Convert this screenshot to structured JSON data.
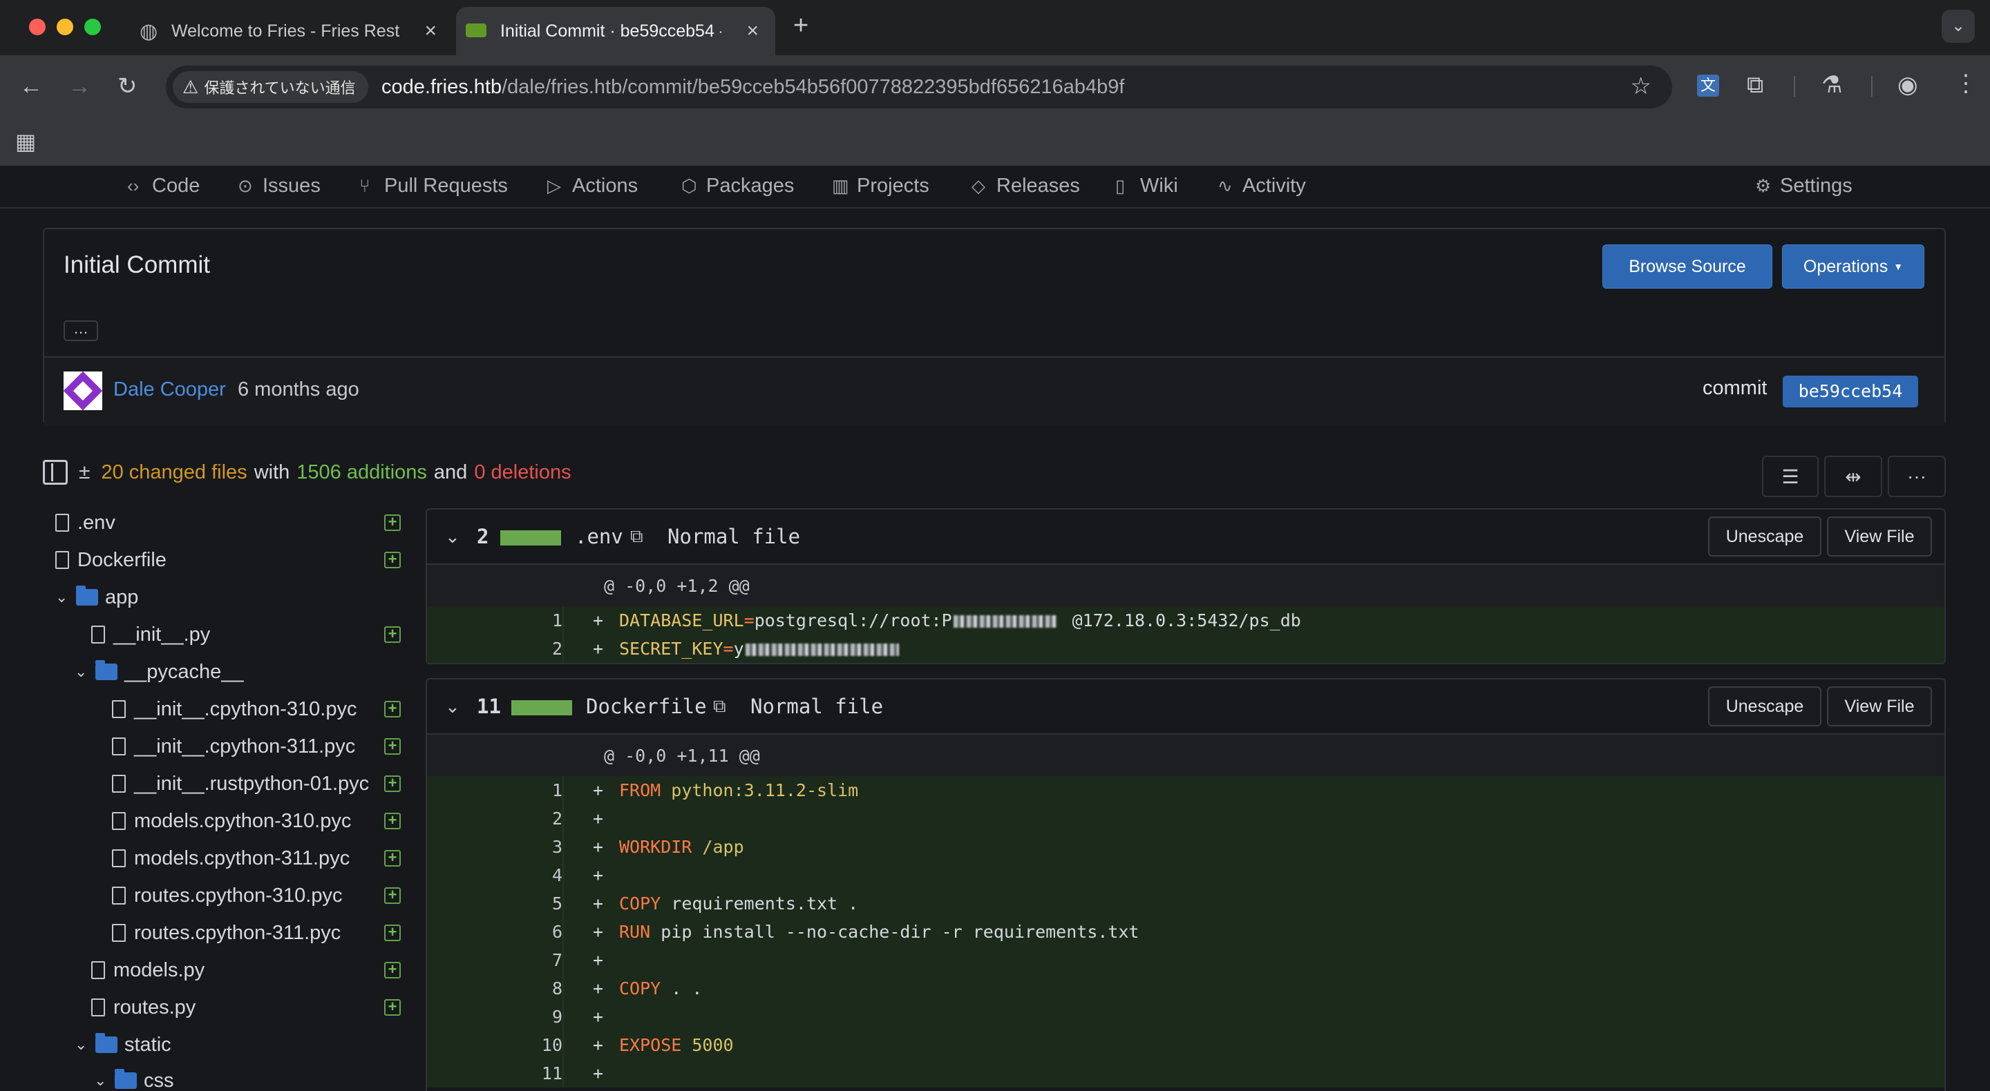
{
  "browser": {
    "tabs": [
      {
        "title": "Welcome to Fries - Fries Rest",
        "active": false
      },
      {
        "title": "Initial Commit · be59cceb54 -",
        "active": true
      }
    ],
    "security_label": "保護されていない通信",
    "url_host": "code.fries.htb",
    "url_path": "/dale/fries.htb/commit/be59cceb54b56f00778822395bdf656216ab4b9f"
  },
  "repo_nav": {
    "items": [
      {
        "label": "Code",
        "icon": "code-icon"
      },
      {
        "label": "Issues",
        "icon": "issue-icon"
      },
      {
        "label": "Pull Requests",
        "icon": "pull-request-icon"
      },
      {
        "label": "Actions",
        "icon": "play-icon"
      },
      {
        "label": "Packages",
        "icon": "package-icon"
      },
      {
        "label": "Projects",
        "icon": "project-icon"
      },
      {
        "label": "Releases",
        "icon": "tag-icon"
      },
      {
        "label": "Wiki",
        "icon": "book-icon"
      },
      {
        "label": "Activity",
        "icon": "pulse-icon"
      }
    ],
    "settings": "Settings"
  },
  "commit": {
    "title": "Initial Commit",
    "browse_source": "Browse Source",
    "operations": "Operations",
    "ellipsis": "…",
    "author": "Dale Cooper",
    "time": "6 months ago",
    "commit_label": "commit",
    "sha": "be59cceb54"
  },
  "stats": {
    "changed": "20 changed files",
    "with": "with",
    "additions": "1506 additions",
    "and": "and",
    "deletions": "0 deletions"
  },
  "tree": [
    {
      "name": ".env",
      "type": "file",
      "level": 0
    },
    {
      "name": "Dockerfile",
      "type": "file",
      "level": 0
    },
    {
      "name": "app",
      "type": "dir",
      "level": 0
    },
    {
      "name": "__init__.py",
      "type": "file",
      "level": 1
    },
    {
      "name": "__pycache__",
      "type": "dir",
      "level": 1
    },
    {
      "name": "__init__.cpython-310.pyc",
      "type": "file",
      "level": 2
    },
    {
      "name": "__init__.cpython-311.pyc",
      "type": "file",
      "level": 2
    },
    {
      "name": "__init__.rustpython-01.pyc",
      "type": "file",
      "level": 2
    },
    {
      "name": "models.cpython-310.pyc",
      "type": "file",
      "level": 2
    },
    {
      "name": "models.cpython-311.pyc",
      "type": "file",
      "level": 2
    },
    {
      "name": "routes.cpython-310.pyc",
      "type": "file",
      "level": 2
    },
    {
      "name": "routes.cpython-311.pyc",
      "type": "file",
      "level": 2
    },
    {
      "name": "models.py",
      "type": "file",
      "level": 1
    },
    {
      "name": "routes.py",
      "type": "file",
      "level": 1
    },
    {
      "name": "static",
      "type": "dir",
      "level": 1
    },
    {
      "name": "css",
      "type": "dir",
      "level": 2
    }
  ],
  "diffs": {
    "env": {
      "count": "2",
      "filename": ".env",
      "mode": "Normal file",
      "unescape": "Unescape",
      "view": "View File",
      "hunk": "@ -0,0 +1,2 @@",
      "lines": [
        {
          "n": "1",
          "key": "DATABASE_URL",
          "eq": "=",
          "pre": "postgresql://root:P",
          "post": "@172.18.0.3:5432/ps_db"
        },
        {
          "n": "2",
          "key": "SECRET_KEY",
          "eq": "=",
          "pre": "y",
          "post": ""
        }
      ]
    },
    "docker": {
      "count": "11",
      "filename": "Dockerfile",
      "mode": "Normal file",
      "unescape": "Unescape",
      "view": "View File",
      "hunk": "@ -0,0 +1,11 @@",
      "lines": [
        {
          "n": "1",
          "kw": "FROM",
          "rest": "python:3.11.2-slim",
          "restClass": "val"
        },
        {
          "n": "2",
          "kw": "",
          "rest": ""
        },
        {
          "n": "3",
          "kw": "WORKDIR",
          "rest": "/app",
          "restClass": "val"
        },
        {
          "n": "4",
          "kw": "",
          "rest": ""
        },
        {
          "n": "5",
          "kw": "COPY",
          "rest": "requirements.txt ."
        },
        {
          "n": "6",
          "kw": "RUN",
          "rest": "pip install --no-cache-dir -r requirements.txt"
        },
        {
          "n": "7",
          "kw": "",
          "rest": ""
        },
        {
          "n": "8",
          "kw": "COPY",
          "rest": ". ."
        },
        {
          "n": "9",
          "kw": "",
          "rest": ""
        },
        {
          "n": "10",
          "kw": "EXPOSE",
          "rest": "5000",
          "restClass": "val"
        },
        {
          "n": "11",
          "kw": "",
          "rest": ""
        }
      ]
    }
  },
  "colors": {
    "accent_blue": "#2e67b2",
    "changed": "#d29922",
    "additions": "#6fbf50",
    "deletions": "#e5534b"
  }
}
